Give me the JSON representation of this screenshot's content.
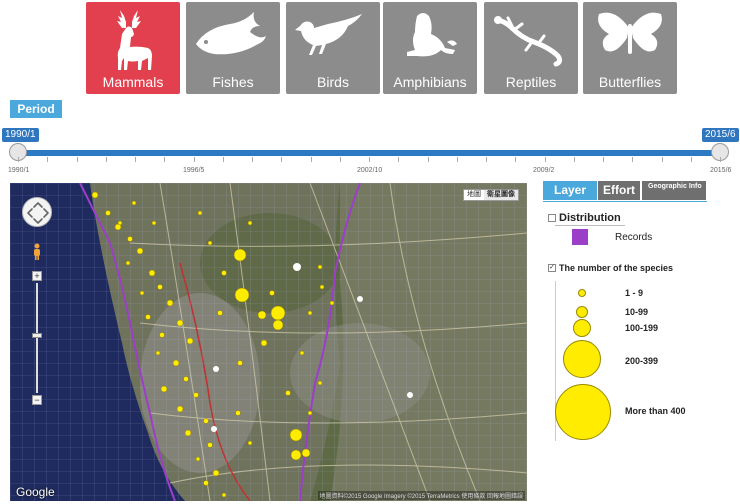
{
  "taxa": [
    {
      "label": "Mammals",
      "icon": "deer-icon",
      "active": true
    },
    {
      "label": "Fishes",
      "icon": "fish-icon",
      "active": false
    },
    {
      "label": "Birds",
      "icon": "bird-icon",
      "active": false
    },
    {
      "label": "Amphibians",
      "icon": "frog-icon",
      "active": false
    },
    {
      "label": "Reptiles",
      "icon": "lizard-icon",
      "active": false
    },
    {
      "label": "Butterflies",
      "icon": "butterfly-icon",
      "active": false
    }
  ],
  "colors": {
    "active_tile": "#e2404e",
    "tile": "#8c8c8c",
    "accent": "#4aa8dc",
    "records": "#9b3fc9",
    "species_circle": "#ffec00"
  },
  "period": {
    "label": "Period",
    "start": "1990/1",
    "end": "2015/6",
    "ticks": [
      "1990/1",
      "1996/5",
      "2002/10",
      "2009/2",
      "2015/6"
    ]
  },
  "map": {
    "type_options": [
      "地圖",
      "衛星圖像"
    ],
    "selected_type": "衛星圖像",
    "logo": "Google",
    "credit": "地圖資料©2015 Google Imagery ©2015 TerraMetrics  使用條款  回報地圖錯誤"
  },
  "panel": {
    "tabs": [
      "Layer",
      "Effort",
      "Geographic Info"
    ],
    "active_tab": "Layer",
    "distribution": {
      "label": "Distribution",
      "checked": false,
      "records_label": "Records"
    },
    "species": {
      "label": "The number of the species",
      "checked": true
    },
    "legend": [
      "1 - 9",
      "10-99",
      "100-199",
      "200-399",
      "More than 400"
    ]
  }
}
